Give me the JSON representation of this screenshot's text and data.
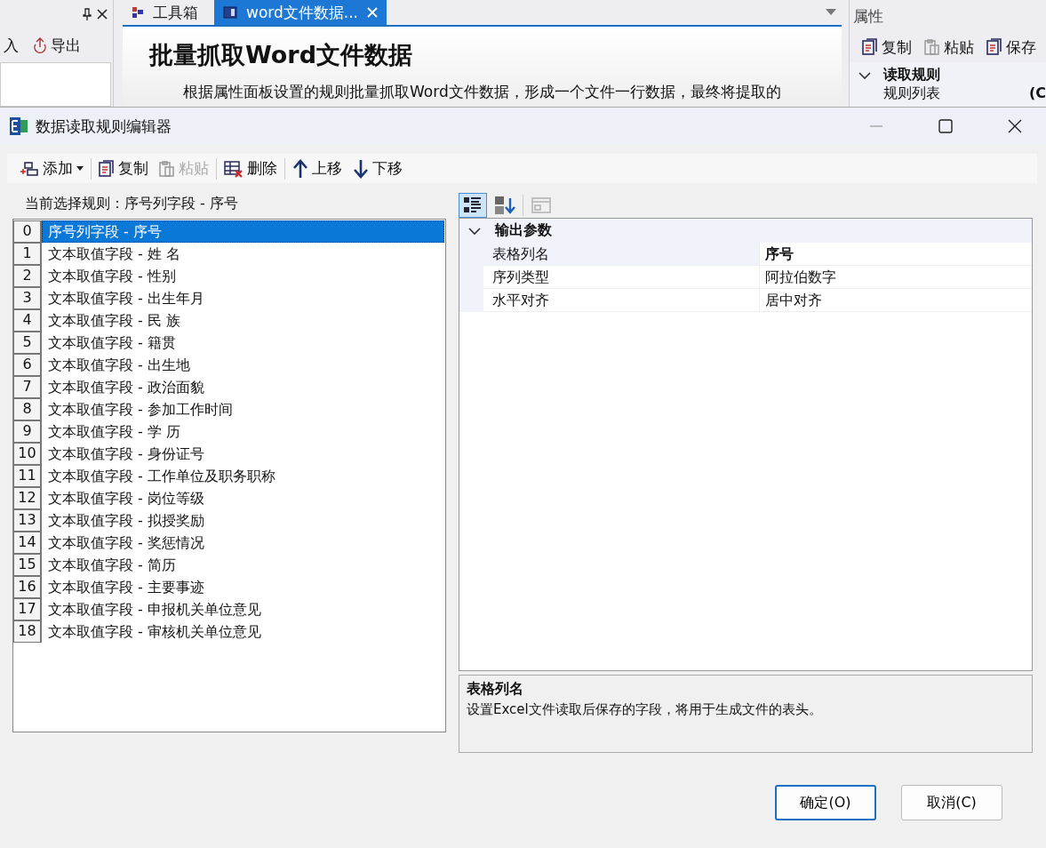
{
  "background": {
    "left_panel": {
      "toolbar": [
        {
          "label": "入"
        },
        {
          "label": "导出"
        }
      ]
    },
    "tabs": [
      {
        "label": "工具箱",
        "selected": false
      },
      {
        "label": "word文件数据...",
        "selected": true
      }
    ],
    "document": {
      "heading": "批量抓取Word文件数据",
      "description": "根据属性面板设置的规则批量抓取Word文件数据，形成一个文件一行数据，最终将提取的"
    },
    "properties": {
      "title": "属性",
      "toolbar": [
        "复制",
        "粘贴",
        "保存"
      ],
      "category": {
        "label": "读取规则",
        "expanded": true
      },
      "rows": [
        {
          "name": "规则列表",
          "value": "(C"
        }
      ]
    }
  },
  "dialog": {
    "title": "数据读取规则编辑器",
    "toolbar": [
      {
        "label": "添加",
        "kind": "add",
        "disabled": false
      },
      {
        "label": "复制",
        "kind": "copy",
        "disabled": false
      },
      {
        "label": "粘贴",
        "kind": "paste",
        "disabled": true
      },
      {
        "label": "删除",
        "kind": "delete",
        "disabled": false
      },
      {
        "label": "上移",
        "kind": "up",
        "disabled": false
      },
      {
        "label": "下移",
        "kind": "down",
        "disabled": false
      }
    ],
    "current_rule": "当前选择规则：序号列字段 - 序号",
    "rules": [
      {
        "index": "0",
        "label": "序号列字段 - 序号",
        "selected": true
      },
      {
        "index": "1",
        "label": "文本取值字段 - 姓  名",
        "selected": false
      },
      {
        "index": "2",
        "label": "文本取值字段 - 性别",
        "selected": false
      },
      {
        "index": "3",
        "label": "文本取值字段 - 出生年月",
        "selected": false
      },
      {
        "index": "4",
        "label": "文本取值字段 - 民  族",
        "selected": false
      },
      {
        "index": "5",
        "label": "文本取值字段 - 籍贯",
        "selected": false
      },
      {
        "index": "6",
        "label": "文本取值字段 - 出生地",
        "selected": false
      },
      {
        "index": "7",
        "label": "文本取值字段 - 政治面貌",
        "selected": false
      },
      {
        "index": "8",
        "label": "文本取值字段 - 参加工作时间",
        "selected": false
      },
      {
        "index": "9",
        "label": "文本取值字段 - 学  历",
        "selected": false
      },
      {
        "index": "10",
        "label": "文本取值字段 - 身份证号",
        "selected": false
      },
      {
        "index": "11",
        "label": "文本取值字段 - 工作单位及职务职称",
        "selected": false
      },
      {
        "index": "12",
        "label": "文本取值字段 - 岗位等级",
        "selected": false
      },
      {
        "index": "13",
        "label": "文本取值字段 - 拟授奖励",
        "selected": false
      },
      {
        "index": "14",
        "label": "文本取值字段 - 奖惩情况",
        "selected": false
      },
      {
        "index": "15",
        "label": "文本取值字段 - 简历",
        "selected": false
      },
      {
        "index": "16",
        "label": "文本取值字段 - 主要事迹",
        "selected": false
      },
      {
        "index": "17",
        "label": "文本取值字段 - 申报机关单位意见",
        "selected": false
      },
      {
        "index": "18",
        "label": "文本取值字段 - 审核机关单位意见",
        "selected": false
      }
    ],
    "property_toolbar": [
      {
        "kind": "categorized",
        "selected": true,
        "disabled": false
      },
      {
        "kind": "alphabetical",
        "selected": false,
        "disabled": false
      },
      {
        "kind": "pages",
        "selected": false,
        "disabled": true
      }
    ],
    "property_grid": {
      "category": {
        "label": "输出参数",
        "expanded": true
      },
      "rows": [
        {
          "name": "表格列名",
          "value": "序号",
          "selected": true,
          "modified": true
        },
        {
          "name": "序列类型",
          "value": "阿拉伯数字",
          "selected": false,
          "modified": false
        },
        {
          "name": "水平对齐",
          "value": "居中对齐",
          "selected": false,
          "modified": false
        }
      ]
    },
    "description": {
      "title": "表格列名",
      "text": "设置Excel文件读取后保存的字段，将用于生成文件的表头。"
    },
    "buttons": [
      {
        "label": "确定(O)",
        "default": true
      },
      {
        "label": "取消(C)",
        "default": false
      }
    ]
  }
}
